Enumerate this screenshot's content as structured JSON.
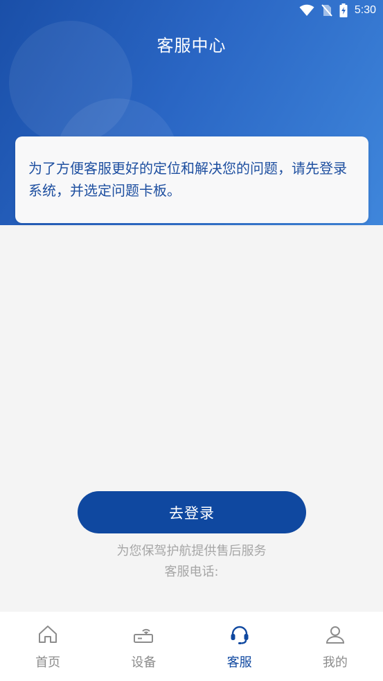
{
  "status_bar": {
    "time": "5:30"
  },
  "header": {
    "title": "客服中心"
  },
  "notice": {
    "text": "为了方便客服更好的定位和解决您的问题，请先登录系统，并选定问题卡板。"
  },
  "login_button": {
    "label": "去登录"
  },
  "footer_text": {
    "tagline": "为您保驾护航提供售后服务",
    "phone_label": "客服电话:"
  },
  "tabbar": {
    "items": [
      {
        "label": "首页",
        "icon": "home-icon",
        "active": false
      },
      {
        "label": "设备",
        "icon": "router-icon",
        "active": false
      },
      {
        "label": "客服",
        "icon": "headset-icon",
        "active": true
      },
      {
        "label": "我的",
        "icon": "user-icon",
        "active": false
      }
    ]
  },
  "colors": {
    "primary": "#0f48a0",
    "header_gradient_start": "#1a4fa8",
    "header_gradient_end": "#3f86db",
    "inactive": "#8c8c8c",
    "muted_text": "#a6a6a6"
  }
}
